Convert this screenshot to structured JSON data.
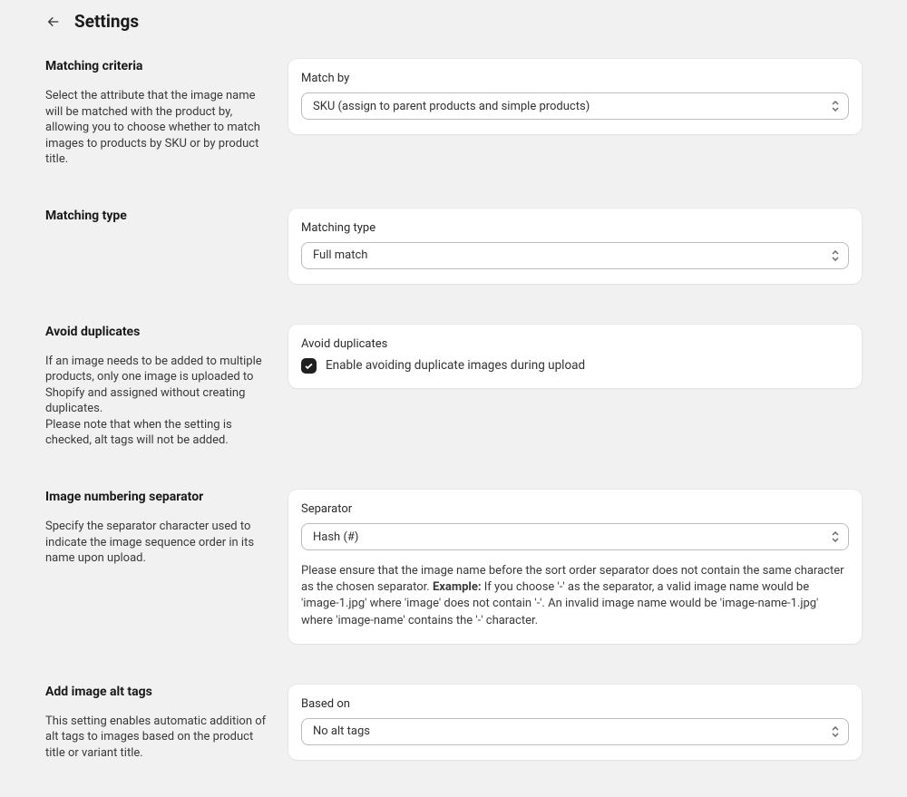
{
  "page_title": "Settings",
  "sections": {
    "matching_criteria": {
      "title": "Matching criteria",
      "desc": "Select the attribute that the image name will be matched with the product by, allowing you to choose whether to match images to products by SKU or by product title.",
      "field_label": "Match by",
      "value": "SKU (assign to parent products and simple products)"
    },
    "matching_type": {
      "title": "Matching type",
      "field_label": "Matching type",
      "value": "Full match"
    },
    "avoid_duplicates": {
      "title": "Avoid duplicates",
      "desc": "If an image needs to be added to multiple products, only one image is uploaded to Shopify and assigned without creating duplicates.\nPlease note that when the setting is checked, alt tags will not be added.",
      "field_label": "Avoid duplicates",
      "checkbox_label": "Enable avoiding duplicate images during upload",
      "checked": true
    },
    "separator": {
      "title": "Image numbering separator",
      "desc": "Specify the separator character used to indicate the image sequence order in its name upon upload.",
      "field_label": "Separator",
      "value": "Hash (#)",
      "helper_before": "Please ensure that the image name before the sort order separator does not contain the same character as the chosen separator. ",
      "helper_bold": "Example:",
      "helper_after": " If you choose '-' as the separator, a valid image name would be 'image-1.jpg' where 'image' does not contain '-'. An invalid image name would be 'image-name-1.jpg' where 'image-name' contains the '-' character."
    },
    "alt_tags": {
      "title": "Add image alt tags",
      "desc": "This setting enables automatic addition of alt tags to images based on the product title or variant title.",
      "field_label": "Based on",
      "value": "No alt tags"
    }
  }
}
